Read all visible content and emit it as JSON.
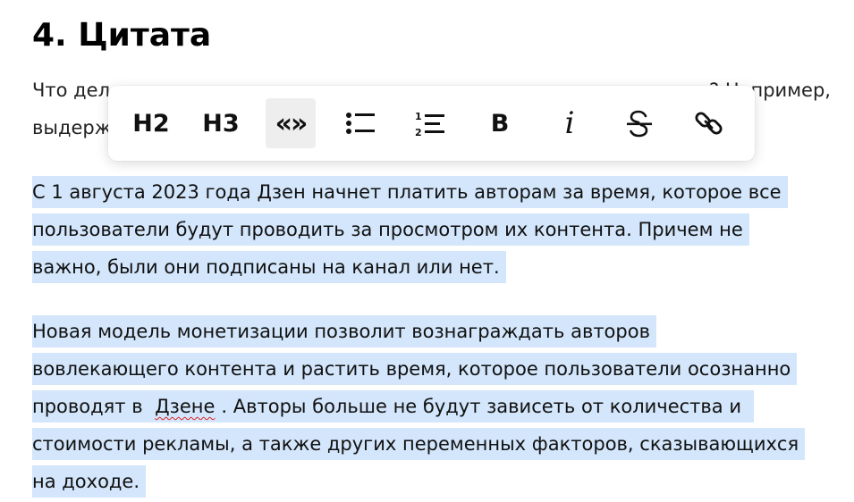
{
  "heading": "4. Цитата",
  "intro": {
    "line1_left": "Что дел",
    "line1_right": "? Например,",
    "line2_left": "выдерж"
  },
  "toolbar": {
    "h2": "H2",
    "h3": "H3",
    "quote": "«»",
    "bold": "B",
    "italic": "i"
  },
  "paragraph1": {
    "lines": [
      "С 1 августа 2023 года Дзен начнет платить авторам за время, которое все",
      "пользователи будут проводить за просмотром их контента. Причем не",
      "важно, были они подписаны на канал или нет."
    ]
  },
  "paragraph2": {
    "line1": "Новая модель монетизации позволит вознаграждать авторов",
    "line2": "вовлекающего контента и растить время, которое пользователи осознанно",
    "line3_before": "проводят в ",
    "line3_word": "Дзене",
    "line3_after": ". Авторы больше не будут зависеть от количества и",
    "line4": "стоимости рекламы, а также других переменных факторов, сказывающихся",
    "line5": "на доходе."
  }
}
